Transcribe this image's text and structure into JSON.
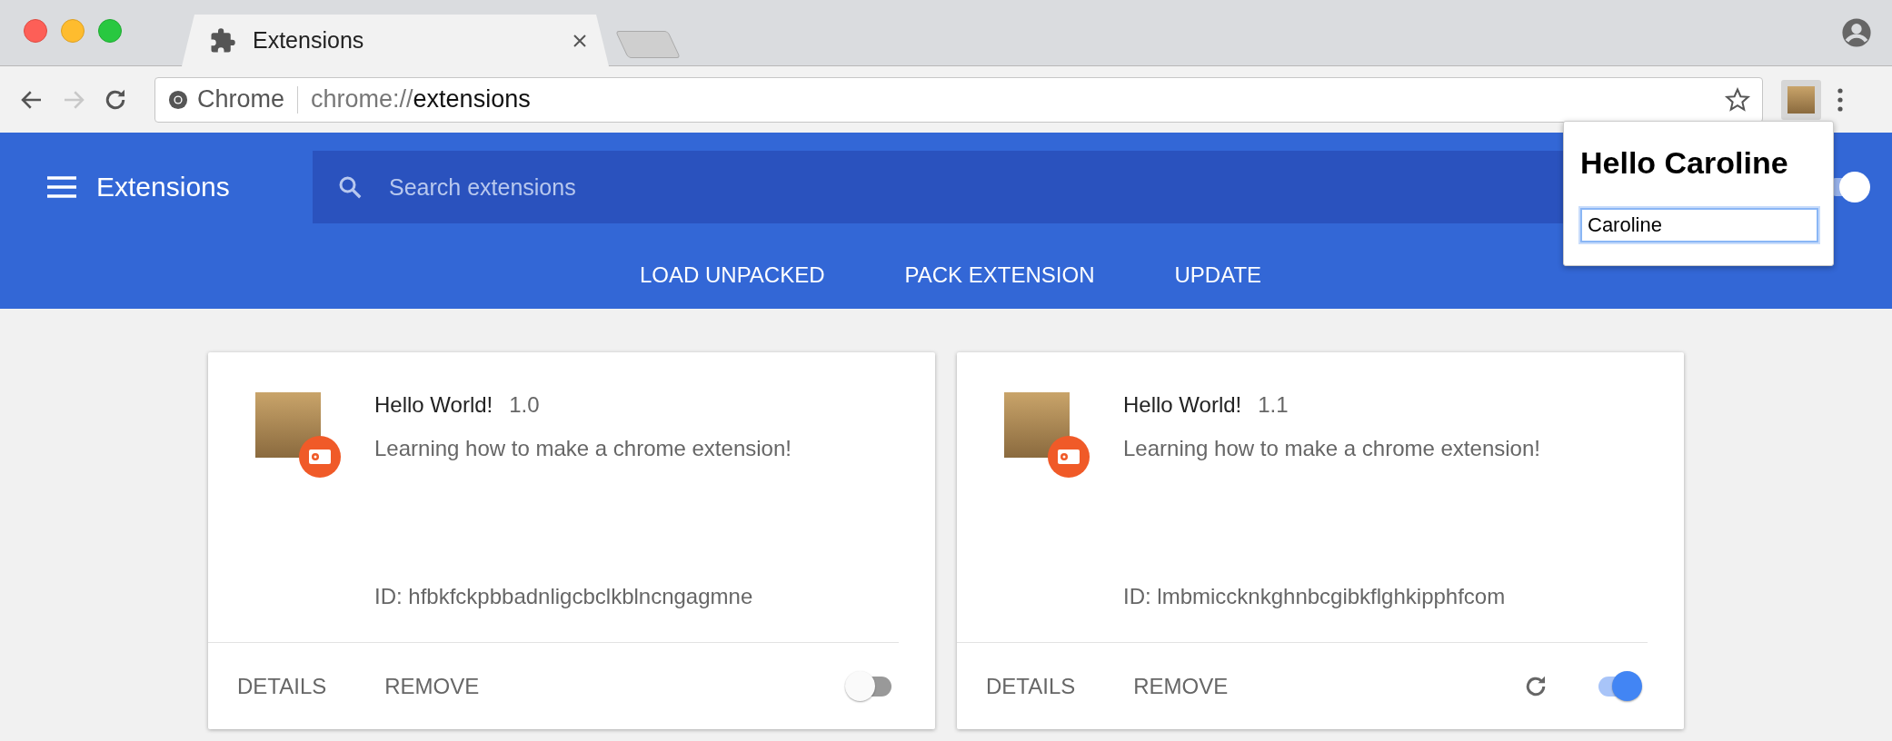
{
  "tab": {
    "title": "Extensions"
  },
  "omnibox": {
    "site_label": "Chrome",
    "url_scheme": "chrome://",
    "url_path": "extensions"
  },
  "header": {
    "title": "Extensions",
    "search": {
      "placeholder": "Search extensions"
    },
    "developer_mode": {
      "on": true
    },
    "actions": [
      "LOAD UNPACKED",
      "PACK EXTENSION",
      "UPDATE"
    ]
  },
  "popup": {
    "heading": "Hello Caroline",
    "input_value": "Caroline"
  },
  "extensions": [
    {
      "name": "Hello World!",
      "version": "1.0",
      "description": "Learning how to make a chrome extension!",
      "id_text": "ID: hfbkfckpbbadnligcbclkblncngagmne",
      "details": "DETAILS",
      "remove": "REMOVE",
      "reload_button": false,
      "enabled": false
    },
    {
      "name": "Hello World!",
      "version": "1.1",
      "description": "Learning how to make a chrome extension!",
      "id_text": "ID: lmbmiccknkghnbcgibkflghkipphfcom",
      "details": "DETAILS",
      "remove": "REMOVE",
      "reload_button": true,
      "enabled": true
    }
  ]
}
